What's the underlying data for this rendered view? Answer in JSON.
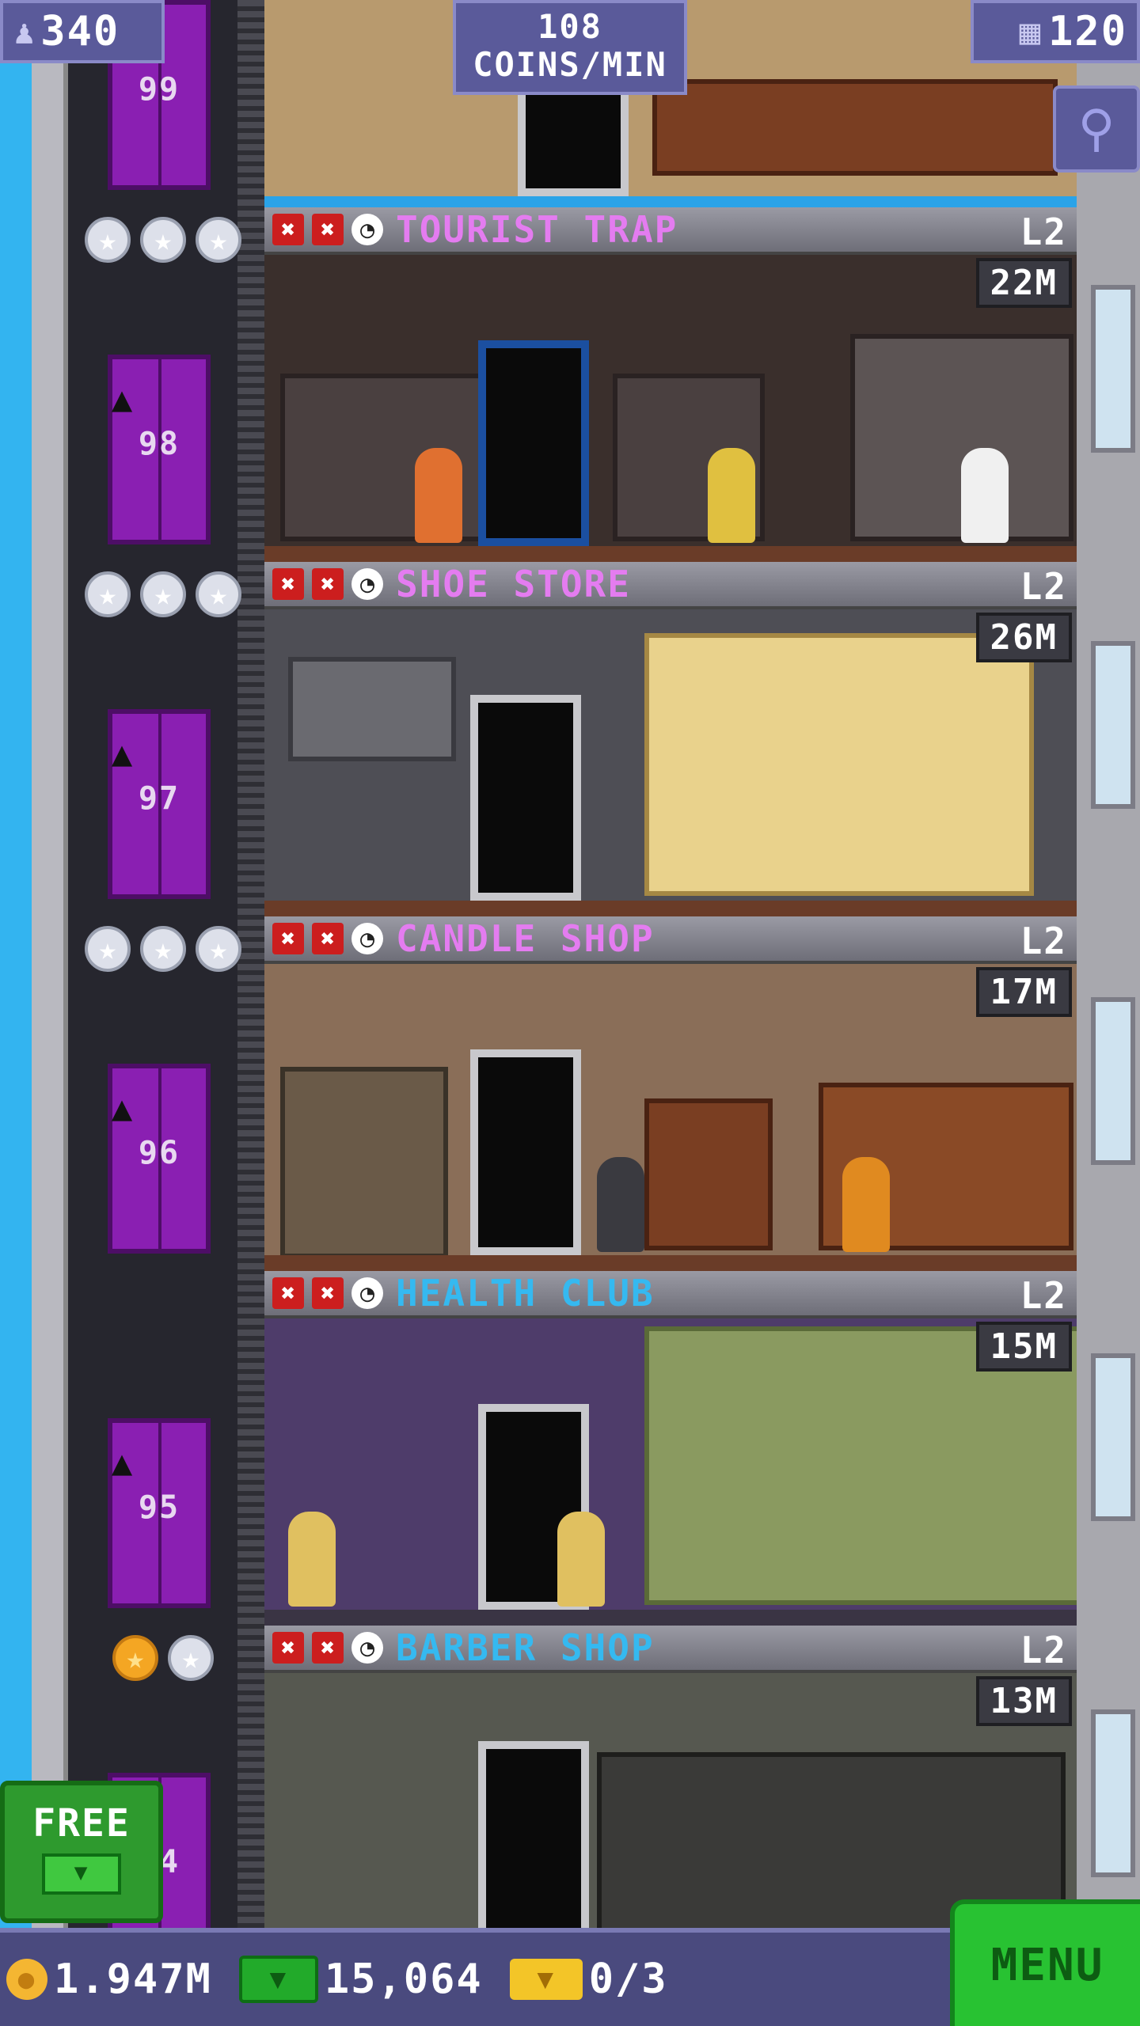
{
  "hud": {
    "population": "340",
    "coins_rate_value": "108",
    "coins_rate_unit": "COINS/MIN",
    "floor_count": "120",
    "icons": {
      "population": "person-icon",
      "floors": "building-icon",
      "zoom": "magnifier-icon"
    }
  },
  "elevator_floors": [
    {
      "number": "99",
      "stars": []
    },
    {
      "number": "98",
      "stars": [
        "silver",
        "silver",
        "silver"
      ]
    },
    {
      "number": "97",
      "stars": [
        "silver",
        "silver",
        "silver"
      ]
    },
    {
      "number": "96",
      "stars": [
        "silver",
        "silver",
        "silver"
      ]
    },
    {
      "number": "95",
      "stars": []
    },
    {
      "number": "94",
      "stars": [
        "gold",
        "silver"
      ]
    }
  ],
  "floors": [
    {
      "name": "TOURIST TRAP",
      "level": "L2",
      "stock": "22M",
      "name_color": "#e47cf0",
      "wall_color": "#3a2f2c"
    },
    {
      "name": "SHOE STORE",
      "level": "L2",
      "stock": "26M",
      "name_color": "#e47cf0",
      "wall_color": "#4e4e55"
    },
    {
      "name": "CANDLE SHOP",
      "level": "L2",
      "stock": "17M",
      "name_color": "#e47cf0",
      "wall_color": "#8a6e58"
    },
    {
      "name": "HEALTH CLUB",
      "level": "L2",
      "stock": "15M",
      "name_color": "#35b9f0",
      "wall_color": "#4e3c6a"
    },
    {
      "name": "BARBER SHOP",
      "level": "L2",
      "stock": "13M",
      "name_color": "#35b9f0",
      "wall_color": "#565850"
    }
  ],
  "bottom_bar": {
    "coins": "1.947M",
    "tower_bux": "15,064",
    "tickets": "0/3",
    "menu_label": "MENU",
    "free_label": "FREE"
  },
  "colors": {
    "elevator_purple": "#8a1fb2",
    "hud_bg": "#5a5a9a",
    "menu_green": "#28c232"
  }
}
